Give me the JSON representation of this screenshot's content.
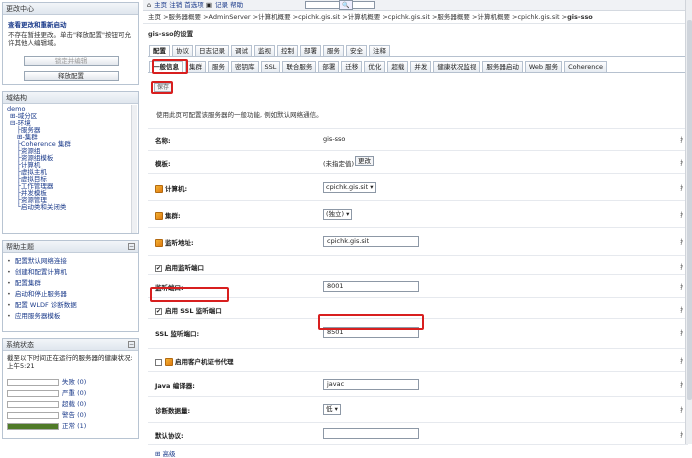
{
  "change_center": {
    "title": "更改中心",
    "link": "查看更改和重新启动",
    "text": "不存在暂挂更改。单击\"释放配置\"按钮可允许其他人编辑域。",
    "lock_button": "锁定并编辑",
    "release_button": "释放配置"
  },
  "domain_structure": {
    "title": "域结构",
    "items": [
      "demo",
      "⊞-域分区",
      "⊟-环境",
      "├服务器",
      "⊞-集群",
      "├Coherence 集群",
      "├资源组",
      "├资源组模板",
      "├计算机",
      "├虚拟主机",
      "├虚拟目标",
      "├工作管理器",
      "├并发模板",
      "├资源管理",
      "└启动类和关闭类"
    ]
  },
  "help_topics": {
    "title": "帮助主题",
    "items": [
      "配置默认网络连接",
      "创建和配置计算机",
      "配置集群",
      "启动和停止服务器",
      "配置 WLDF 诊断数据",
      "应用服务器模板"
    ]
  },
  "system_status": {
    "title": "系统状态",
    "desc": "截至以下时间正在运行的服务器的健康状况: 上午5:21",
    "rows": [
      {
        "label": "失败 (0)",
        "color": "#ffffff",
        "fill": 0
      },
      {
        "label": "严重 (0)",
        "color": "#ffffff",
        "fill": 0
      },
      {
        "label": "超载 (0)",
        "color": "#ffffff",
        "fill": 0
      },
      {
        "label": "警告 (0)",
        "color": "#ffffff",
        "fill": 0
      },
      {
        "label": "正常 (1)",
        "color": "#4f7a28",
        "fill": 1
      }
    ]
  },
  "topbar": {
    "home": "主页",
    "logout": "注销",
    "prefs": "首选项",
    "record": "记录",
    "help": "帮助",
    "search_button": "🔍"
  },
  "breadcrumb": "主页 >服务器概要 >AdminServer >计算机概要 >cpichk.gis.sit >计算机概要 >cpichk.gis.sit >服务器概要 >计算机概要 >cpichk.gis.sit >",
  "breadcrumb_current": "gis-sso",
  "page_title": "gis-sso的设置",
  "tabs1": [
    "配置",
    "协议",
    "日志记录",
    "调试",
    "监视",
    "控制",
    "部署",
    "服务",
    "安全",
    "注释"
  ],
  "tabs2": [
    "一般信息",
    "集群",
    "服务",
    "密钥库",
    "SSL",
    "联合服务",
    "部署",
    "迁移",
    "优化",
    "超载",
    "并发",
    "健康状况监视",
    "服务器启动",
    "Web 服务",
    "Coherence"
  ],
  "save_label": "保存",
  "description": "使用此页可配置该服务器的一般功能, 例如默认网络通信。",
  "form": {
    "name_label": "名称:",
    "name_value": "gis-sso",
    "template_label": "模板:",
    "template_value": "(未指定值)",
    "template_change": "更改",
    "machine_label": "计算机:",
    "machine_value": "cpichk.gis.sit ▾",
    "cluster_label": "集群:",
    "cluster_value": "(独立) ▾",
    "listen_addr_label": "监听地址:",
    "listen_addr_value": "cpichk.gis.sit",
    "listen_port_enabled_label": "启用监听端口",
    "listen_port_label": "监听端口:",
    "listen_port_value": "8001",
    "ssl_enabled_label": "启用 SSL 监听端口",
    "ssl_port_label": "SSL 监听端口:",
    "ssl_port_value": "8501",
    "client_cert_label": "启用客户机证书代理",
    "java_compiler_label": "Java 编译器:",
    "java_compiler_value": "javac",
    "diag_volume_label": "诊断数据量:",
    "diag_volume_value": "低 ▾",
    "default_protocol_label": "默认协议:",
    "advanced_label": "高级"
  },
  "colors": {
    "highlight": "#d81f1f",
    "link": "#1a3a8a"
  }
}
